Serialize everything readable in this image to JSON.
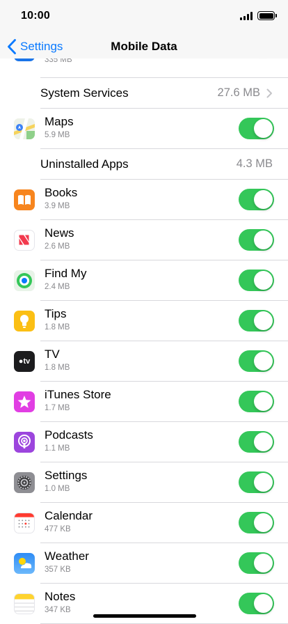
{
  "status_bar": {
    "time": "10:00"
  },
  "nav": {
    "back_label": "Settings",
    "title": "Mobile Data"
  },
  "rows": {
    "partial": {
      "size": "335 MB",
      "enabled": true,
      "icon": "app-store-icon",
      "color": "#1a74e8"
    },
    "system_services": {
      "title": "System Services",
      "value": "27.6 MB"
    },
    "maps": {
      "title": "Maps",
      "size": "5.9 MB",
      "enabled": true,
      "icon": "maps-icon"
    },
    "uninstalled": {
      "title": "Uninstalled Apps",
      "value": "4.3 MB"
    },
    "books": {
      "title": "Books",
      "size": "3.9 MB",
      "enabled": true,
      "icon": "books-icon",
      "color": "#f7851e"
    },
    "news": {
      "title": "News",
      "size": "2.6 MB",
      "enabled": true,
      "icon": "news-icon",
      "color": "#f2394d"
    },
    "find_my": {
      "title": "Find My",
      "size": "2.4 MB",
      "enabled": true,
      "icon": "find-my-icon",
      "color": "#34c759"
    },
    "tips": {
      "title": "Tips",
      "size": "1.8 MB",
      "enabled": true,
      "icon": "tips-icon",
      "color": "#fbbf14"
    },
    "tv": {
      "title": "TV",
      "size": "1.8 MB",
      "enabled": true,
      "icon": "tv-icon",
      "color": "#1c1c1e",
      "icon_text": "tv"
    },
    "itunes": {
      "title": "iTunes Store",
      "size": "1.7 MB",
      "enabled": true,
      "icon": "itunes-star-icon",
      "color": "#e13ee3"
    },
    "podcasts": {
      "title": "Podcasts",
      "size": "1.1 MB",
      "enabled": true,
      "icon": "podcasts-icon",
      "color": "#9c45dd"
    },
    "settings": {
      "title": "Settings",
      "size": "1.0 MB",
      "enabled": true,
      "icon": "gear-icon",
      "color": "#8e8e93"
    },
    "calendar": {
      "title": "Calendar",
      "size": "477 KB",
      "enabled": true,
      "icon": "calendar-icon",
      "color": "#ff3b30"
    },
    "weather": {
      "title": "Weather",
      "size": "357 KB",
      "enabled": true,
      "icon": "weather-icon",
      "color": "#2f8cf5"
    },
    "notes": {
      "title": "Notes",
      "size": "347 KB",
      "enabled": true,
      "icon": "notes-icon",
      "color": "#fed32f"
    }
  },
  "accent": "#0a7aff",
  "toggle_on_color": "#34c759"
}
